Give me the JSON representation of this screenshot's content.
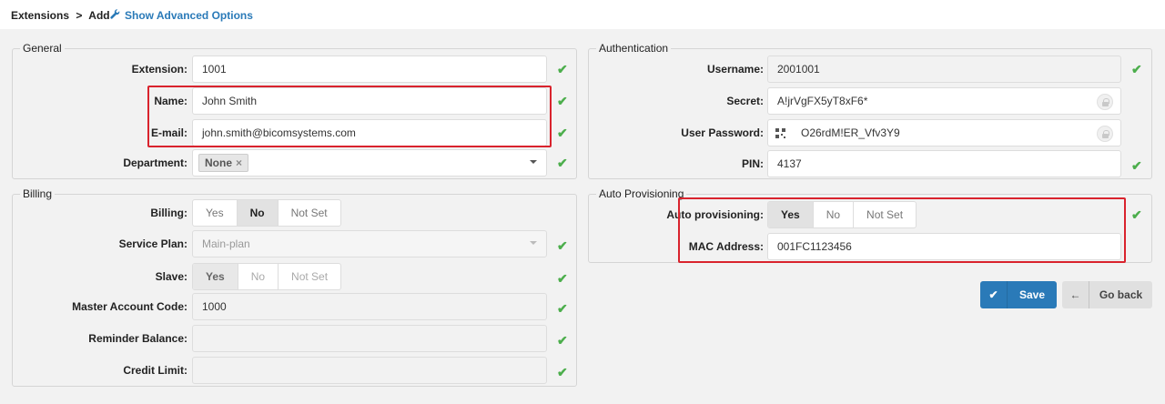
{
  "header": {
    "breadcrumb_root": "Extensions",
    "breadcrumb_sep": ">",
    "breadcrumb_current": "Add",
    "advanced_link": "Show Advanced Options"
  },
  "general": {
    "title": "General",
    "extension_label": "Extension:",
    "extension_value": "1001",
    "name_label": "Name:",
    "name_value": "John Smith",
    "email_label": "E-mail:",
    "email_value": "john.smith@bicomsystems.com",
    "department_label": "Department:",
    "department_tag": "None",
    "department_tag_remove": "×"
  },
  "billing": {
    "title": "Billing",
    "billing_label": "Billing:",
    "billing_options": [
      "Yes",
      "No",
      "Not Set"
    ],
    "billing_selected": "No",
    "service_plan_label": "Service Plan:",
    "service_plan_value": "Main-plan",
    "slave_label": "Slave:",
    "slave_options": [
      "Yes",
      "No",
      "Not Set"
    ],
    "slave_selected": "Yes",
    "master_label": "Master Account Code:",
    "master_value": "1000",
    "reminder_label": "Reminder Balance:",
    "reminder_value": "",
    "credit_label": "Credit Limit:",
    "credit_value": ""
  },
  "authentication": {
    "title": "Authentication",
    "username_label": "Username:",
    "username_value": "2001001",
    "secret_label": "Secret:",
    "secret_value": "A!jrVgFX5yT8xF6*",
    "user_password_label": "User Password:",
    "user_password_value": "O26rdM!ER_Vfv3Y9",
    "pin_label": "PIN:",
    "pin_value": "4137"
  },
  "auto_provisioning": {
    "title": "Auto Provisioning",
    "auto_label": "Auto provisioning:",
    "auto_options": [
      "Yes",
      "No",
      "Not Set"
    ],
    "auto_selected": "Yes",
    "mac_label": "MAC Address:",
    "mac_value": "001FC1123456"
  },
  "actions": {
    "save_label": "Save",
    "go_back_label": "Go back"
  },
  "colors": {
    "accent": "#2a7ab8",
    "check": "#4cae4c",
    "highlight": "#d9232d"
  },
  "icons": [
    "wrench-icon",
    "checkmark-icon",
    "lock-icon",
    "qr-code-icon",
    "chevron-down-icon",
    "arrow-left-icon"
  ]
}
